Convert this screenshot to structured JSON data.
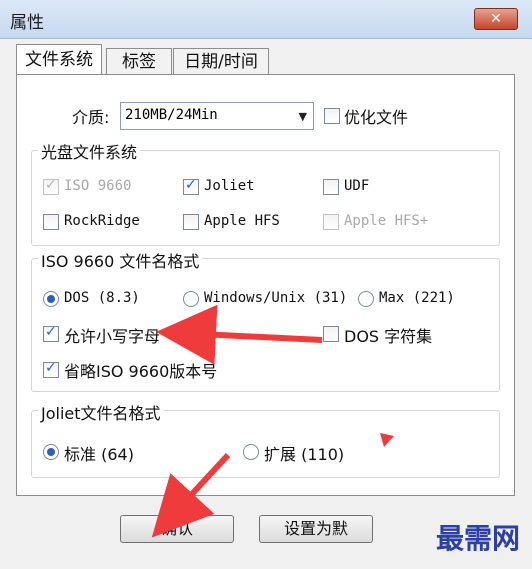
{
  "window": {
    "title": "属性",
    "close_glyph": "✕"
  },
  "tabs": [
    {
      "label": "文件系统",
      "active": true
    },
    {
      "label": "标签"
    },
    {
      "label": "日期/时间"
    }
  ],
  "media": {
    "label": "介质:",
    "selected": "210MB/24Min",
    "optimize_label": "优化文件"
  },
  "disc_fs": {
    "title": "光盘文件系统",
    "options": [
      {
        "label": "ISO 9660",
        "checked": true,
        "disabled": true
      },
      {
        "label": "Joliet",
        "checked": true
      },
      {
        "label": "UDF",
        "checked": false
      },
      {
        "label": "RockRidge",
        "checked": false
      },
      {
        "label": "Apple HFS",
        "checked": false
      },
      {
        "label": "Apple HFS+",
        "checked": false,
        "disabled": true
      }
    ]
  },
  "iso_format": {
    "title": "ISO 9660 文件名格式",
    "radios": [
      {
        "label": "DOS (8.3)",
        "selected": true
      },
      {
        "label": "Windows/Unix (31)"
      },
      {
        "label": "Max (221)"
      }
    ],
    "allow_lowercase": "允许小写字母",
    "dos_charset": "DOS 字符集",
    "omit_version": "省略ISO 9660版本号"
  },
  "joliet_format": {
    "title": "Joliet文件名格式",
    "radios": [
      {
        "label": "标准 (64)",
        "selected": true
      },
      {
        "label": "扩展 (110)"
      }
    ]
  },
  "buttons": {
    "ok": "确认",
    "set_default": "设置为默"
  },
  "watermark": "最需网",
  "colors": {
    "checkmark": "#2b5fb5",
    "arrow": "#ef3b3b",
    "watermark": "#2a3fa8"
  }
}
